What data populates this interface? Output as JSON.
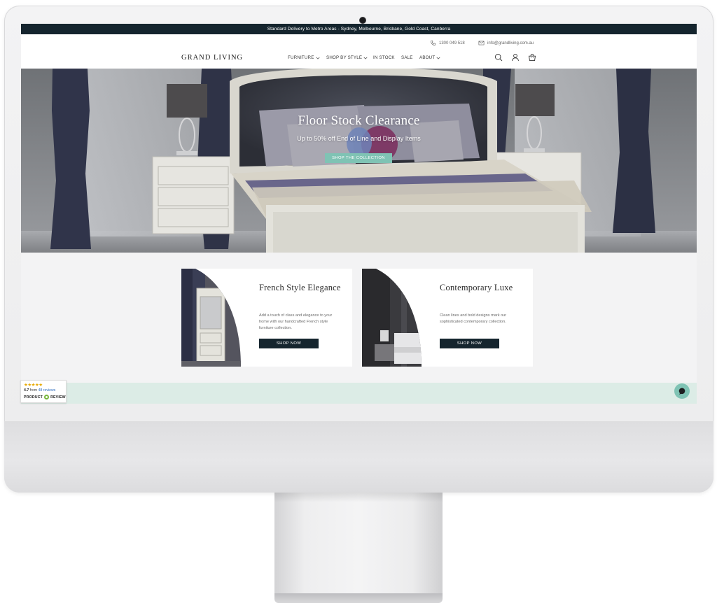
{
  "announcement": "Standard Delivery to Metro Areas - Sydney, Melbourne, Brisbane, Gold Coast, Canberra",
  "header": {
    "phone": "1300 049 518",
    "email": "info@grandliving.com.au",
    "logo": "GRAND LIVING",
    "nav": {
      "furniture": "FURNITURE",
      "shop_by_style": "SHOP BY STYLE",
      "in_stock": "IN STOCK",
      "sale": "SALE",
      "about": "ABOUT"
    },
    "icons": [
      "search-icon",
      "account-icon",
      "cart-icon"
    ]
  },
  "hero": {
    "title": "Floor Stock Clearance",
    "subtitle": "Up to 50% off End of Line and Display Items",
    "button": "SHOP THE COLLECTION"
  },
  "cards": [
    {
      "title": "French Style Elegance",
      "description": "Add a touch of class and elegance to your home with our handcrafted French style furniture collection.",
      "button": "SHOP NOW"
    },
    {
      "title": "Contemporary Luxe",
      "description": "Clean lines and bold designs mark our sophisticated contemporary collection.",
      "button": "SHOP NOW"
    }
  ],
  "reviews_widget": {
    "stars": "★★★★★",
    "score": "4.7",
    "from_text": "from",
    "reviews": "48 reviews",
    "brand_left": "PRODUCT",
    "brand_right": "REVIEW"
  },
  "colors": {
    "announcement_bg": "#15252e",
    "accent_mint": "#7fc3b4",
    "dark_button": "#15252e",
    "mint_band": "#dcece6"
  }
}
